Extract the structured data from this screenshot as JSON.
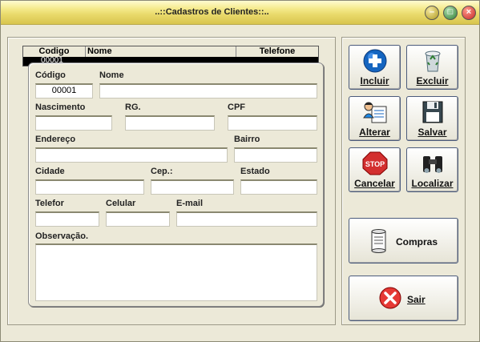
{
  "window": {
    "title": "..::Cadastros de Clientes::..",
    "controls": [
      "minimize-icon",
      "maximize-icon",
      "close-icon"
    ]
  },
  "grid": {
    "columns": [
      "Codigo",
      "Nome",
      "Telefone"
    ],
    "row_code": "00001"
  },
  "form": {
    "codigo_label": "Código",
    "codigo_value": "00001",
    "nome_label": "Nome",
    "nascimento_label": "Nascimento",
    "rg_label": "RG.",
    "cpf_label": "CPF",
    "endereco_label": "Endereço",
    "bairro_label": "Bairro",
    "cidade_label": "Cidade",
    "cep_label": "Cep.:",
    "estado_label": "Estado",
    "telefone_label": "Telefor",
    "celular_label": "Celular",
    "email_label": "E-mail",
    "observacao_label": "Observação."
  },
  "actions": {
    "incluir": "Incluir",
    "excluir": "Excluir",
    "alterar": "Alterar",
    "salvar": "Salvar",
    "cancelar": "Cancelar",
    "localizar": "Localizar",
    "compras": "Compras",
    "sair": "Sair",
    "stop_text": "STOP"
  },
  "colors": {
    "titlebar": "#e9d96a",
    "window_bg": "#ece9d8",
    "incluir_icon": "#1565c0",
    "stop_icon": "#d32f2f",
    "sair_icon": "#e53935"
  }
}
